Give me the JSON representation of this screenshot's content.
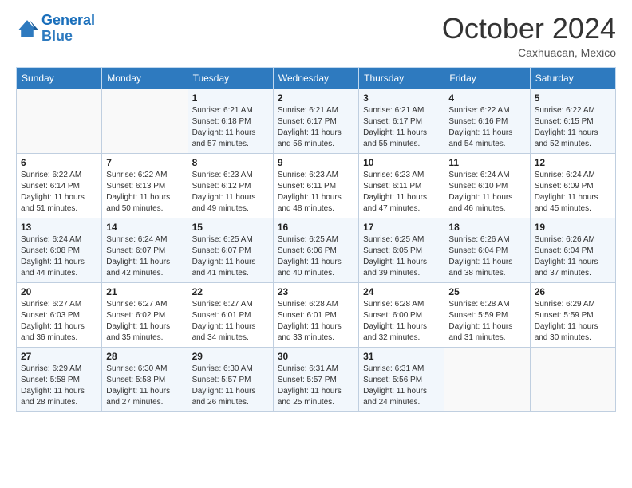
{
  "header": {
    "logo_general": "General",
    "logo_blue": "Blue",
    "month_title": "October 2024",
    "location": "Caxhuacan, Mexico"
  },
  "days_of_week": [
    "Sunday",
    "Monday",
    "Tuesday",
    "Wednesday",
    "Thursday",
    "Friday",
    "Saturday"
  ],
  "weeks": [
    [
      {
        "day": "",
        "info": ""
      },
      {
        "day": "",
        "info": ""
      },
      {
        "day": "1",
        "info": "Sunrise: 6:21 AM\nSunset: 6:18 PM\nDaylight: 11 hours and 57 minutes."
      },
      {
        "day": "2",
        "info": "Sunrise: 6:21 AM\nSunset: 6:17 PM\nDaylight: 11 hours and 56 minutes."
      },
      {
        "day": "3",
        "info": "Sunrise: 6:21 AM\nSunset: 6:17 PM\nDaylight: 11 hours and 55 minutes."
      },
      {
        "day": "4",
        "info": "Sunrise: 6:22 AM\nSunset: 6:16 PM\nDaylight: 11 hours and 54 minutes."
      },
      {
        "day": "5",
        "info": "Sunrise: 6:22 AM\nSunset: 6:15 PM\nDaylight: 11 hours and 52 minutes."
      }
    ],
    [
      {
        "day": "6",
        "info": "Sunrise: 6:22 AM\nSunset: 6:14 PM\nDaylight: 11 hours and 51 minutes."
      },
      {
        "day": "7",
        "info": "Sunrise: 6:22 AM\nSunset: 6:13 PM\nDaylight: 11 hours and 50 minutes."
      },
      {
        "day": "8",
        "info": "Sunrise: 6:23 AM\nSunset: 6:12 PM\nDaylight: 11 hours and 49 minutes."
      },
      {
        "day": "9",
        "info": "Sunrise: 6:23 AM\nSunset: 6:11 PM\nDaylight: 11 hours and 48 minutes."
      },
      {
        "day": "10",
        "info": "Sunrise: 6:23 AM\nSunset: 6:11 PM\nDaylight: 11 hours and 47 minutes."
      },
      {
        "day": "11",
        "info": "Sunrise: 6:24 AM\nSunset: 6:10 PM\nDaylight: 11 hours and 46 minutes."
      },
      {
        "day": "12",
        "info": "Sunrise: 6:24 AM\nSunset: 6:09 PM\nDaylight: 11 hours and 45 minutes."
      }
    ],
    [
      {
        "day": "13",
        "info": "Sunrise: 6:24 AM\nSunset: 6:08 PM\nDaylight: 11 hours and 44 minutes."
      },
      {
        "day": "14",
        "info": "Sunrise: 6:24 AM\nSunset: 6:07 PM\nDaylight: 11 hours and 42 minutes."
      },
      {
        "day": "15",
        "info": "Sunrise: 6:25 AM\nSunset: 6:07 PM\nDaylight: 11 hours and 41 minutes."
      },
      {
        "day": "16",
        "info": "Sunrise: 6:25 AM\nSunset: 6:06 PM\nDaylight: 11 hours and 40 minutes."
      },
      {
        "day": "17",
        "info": "Sunrise: 6:25 AM\nSunset: 6:05 PM\nDaylight: 11 hours and 39 minutes."
      },
      {
        "day": "18",
        "info": "Sunrise: 6:26 AM\nSunset: 6:04 PM\nDaylight: 11 hours and 38 minutes."
      },
      {
        "day": "19",
        "info": "Sunrise: 6:26 AM\nSunset: 6:04 PM\nDaylight: 11 hours and 37 minutes."
      }
    ],
    [
      {
        "day": "20",
        "info": "Sunrise: 6:27 AM\nSunset: 6:03 PM\nDaylight: 11 hours and 36 minutes."
      },
      {
        "day": "21",
        "info": "Sunrise: 6:27 AM\nSunset: 6:02 PM\nDaylight: 11 hours and 35 minutes."
      },
      {
        "day": "22",
        "info": "Sunrise: 6:27 AM\nSunset: 6:01 PM\nDaylight: 11 hours and 34 minutes."
      },
      {
        "day": "23",
        "info": "Sunrise: 6:28 AM\nSunset: 6:01 PM\nDaylight: 11 hours and 33 minutes."
      },
      {
        "day": "24",
        "info": "Sunrise: 6:28 AM\nSunset: 6:00 PM\nDaylight: 11 hours and 32 minutes."
      },
      {
        "day": "25",
        "info": "Sunrise: 6:28 AM\nSunset: 5:59 PM\nDaylight: 11 hours and 31 minutes."
      },
      {
        "day": "26",
        "info": "Sunrise: 6:29 AM\nSunset: 5:59 PM\nDaylight: 11 hours and 30 minutes."
      }
    ],
    [
      {
        "day": "27",
        "info": "Sunrise: 6:29 AM\nSunset: 5:58 PM\nDaylight: 11 hours and 28 minutes."
      },
      {
        "day": "28",
        "info": "Sunrise: 6:30 AM\nSunset: 5:58 PM\nDaylight: 11 hours and 27 minutes."
      },
      {
        "day": "29",
        "info": "Sunrise: 6:30 AM\nSunset: 5:57 PM\nDaylight: 11 hours and 26 minutes."
      },
      {
        "day": "30",
        "info": "Sunrise: 6:31 AM\nSunset: 5:57 PM\nDaylight: 11 hours and 25 minutes."
      },
      {
        "day": "31",
        "info": "Sunrise: 6:31 AM\nSunset: 5:56 PM\nDaylight: 11 hours and 24 minutes."
      },
      {
        "day": "",
        "info": ""
      },
      {
        "day": "",
        "info": ""
      }
    ]
  ]
}
